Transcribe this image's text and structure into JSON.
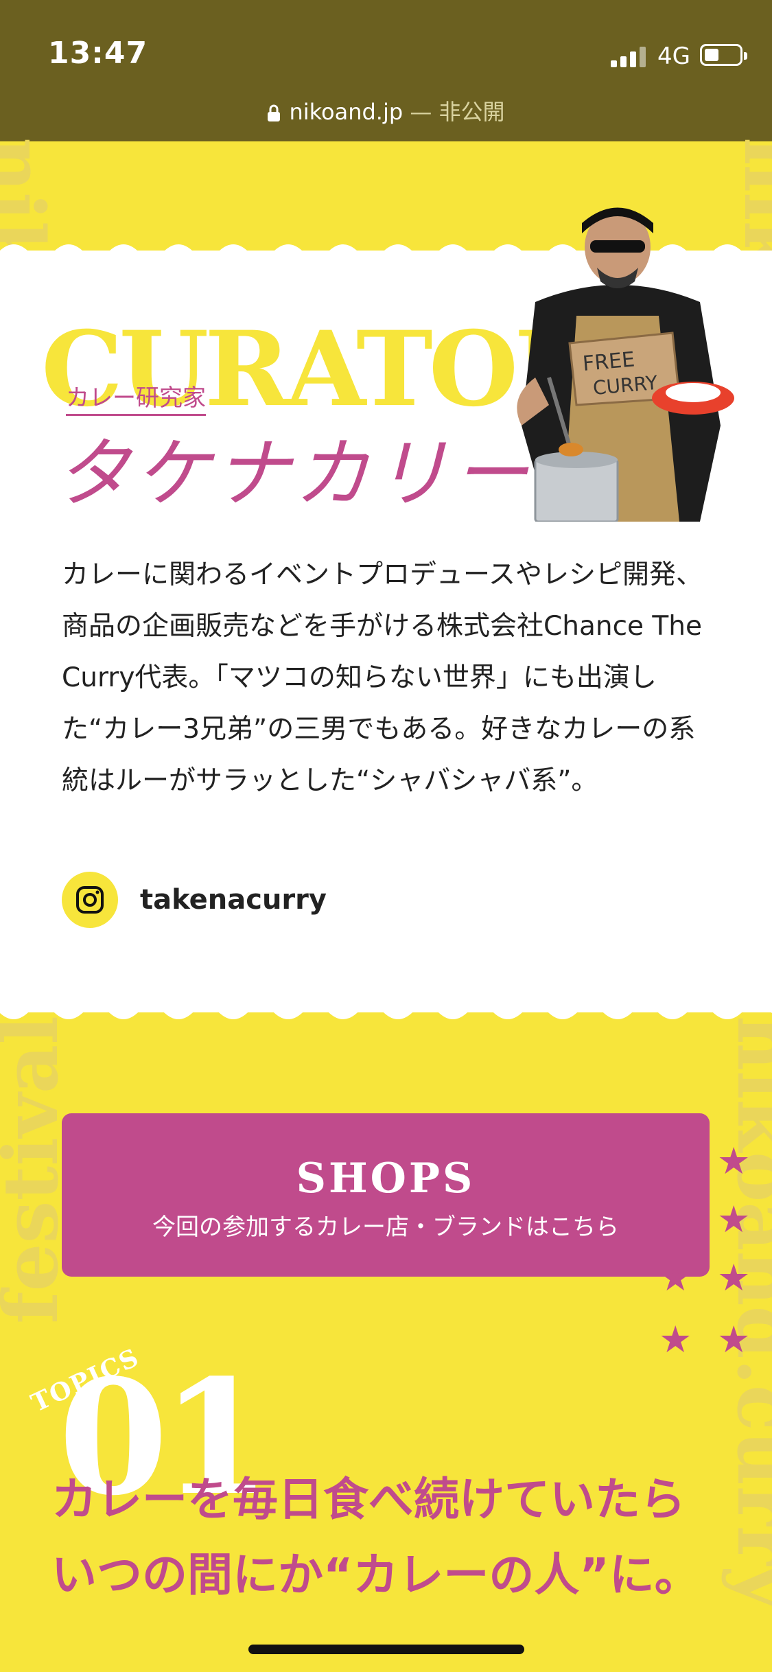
{
  "status_bar": {
    "time": "13:47",
    "network": "4G"
  },
  "browser": {
    "domain": "nikoand.jp",
    "visibility": "— 非公開"
  },
  "decor": {
    "side_text_left": "nikoand.curry",
    "side_text_right": "nikoand.curry",
    "lower_left": "festival"
  },
  "curator": {
    "heading_word": "CURATOR",
    "role": "カレー研究家",
    "name": "タケナカリー",
    "photo_sign": "FREE CURRY",
    "bio": "カレーに関わるイベントプロデュースやレシピ開発、商品の企画販売などを手がける株式会社Chance The Curry代表。「マツコの知らない世界」にも出演した“カレー3兄弟”の三男でもある。好きなカレーの系統はルーがサラッとした“シャバシャバ系”。",
    "instagram_handle": "takenacurry"
  },
  "shops_button": {
    "title": "SHOPS",
    "subtitle": "今回の参加するカレー店・ブランドはこちら"
  },
  "topic": {
    "label": "TOPICS",
    "number": "01",
    "headline_line1": "カレーを毎日食べ続けていたら",
    "headline_line2": "いつの間にか“カレーの人”に。"
  },
  "colors": {
    "yellow": "#f7e53b",
    "magenta": "#c04b8c",
    "status_bar": "#6b6020"
  }
}
